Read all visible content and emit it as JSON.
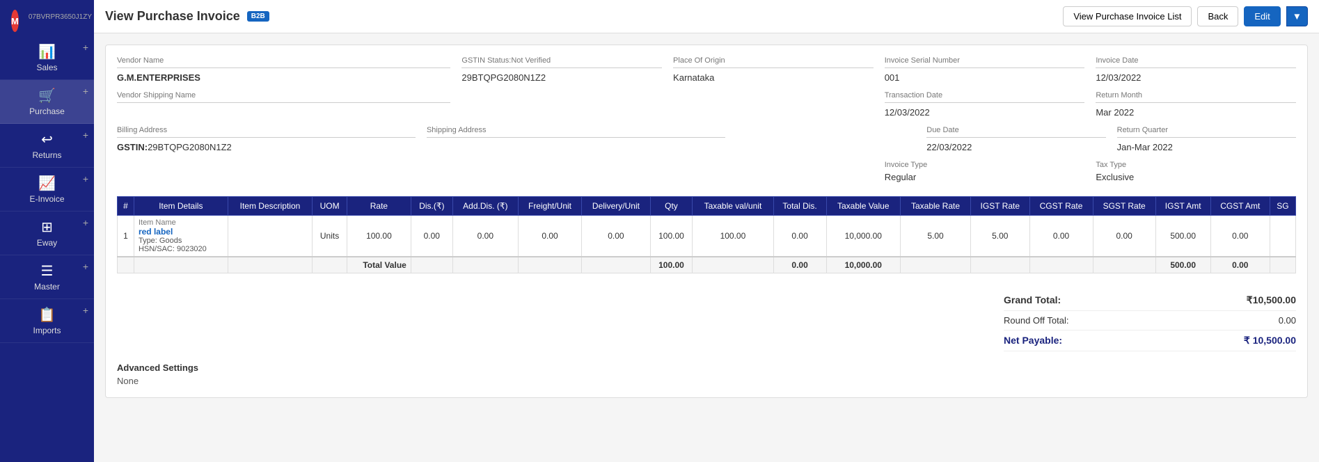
{
  "app": {
    "logo": "M",
    "logo_company": "07BVRPR3650J1ZY"
  },
  "sidebar": {
    "items": [
      {
        "label": "Sales",
        "icon": "📊",
        "active": false
      },
      {
        "label": "Purchase",
        "icon": "🛒",
        "active": true
      },
      {
        "label": "Returns",
        "icon": "↩",
        "active": false
      },
      {
        "label": "E-Invoice",
        "icon": "📈",
        "active": false
      },
      {
        "label": "Eway",
        "icon": "⊞",
        "active": false
      },
      {
        "label": "Master",
        "icon": "☰",
        "active": false
      },
      {
        "label": "Imports",
        "icon": "📋",
        "active": false
      }
    ]
  },
  "header": {
    "title": "View Purchase Invoice",
    "badge": "B2B",
    "buttons": {
      "list": "View Purchase Invoice List",
      "back": "Back",
      "edit": "Edit"
    }
  },
  "invoice": {
    "vendor_name_label": "Vendor Name",
    "vendor_name": "G.M.ENTERPRISES",
    "vendor_shipping_label": "Vendor Shipping Name",
    "vendor_shipping": "",
    "gstin_status_label": "GSTIN Status:Not Verified",
    "gstin_value": "29BTQPG2080N1Z2",
    "place_of_origin_label": "Place Of Origin",
    "place_of_origin": "Karnataka",
    "invoice_serial_label": "Invoice Serial Number",
    "invoice_serial": "001",
    "invoice_date_label": "Invoice Date",
    "invoice_date": "12/03/2022",
    "transaction_date_label": "Transaction Date",
    "transaction_date": "12/03/2022",
    "return_month_label": "Return Month",
    "return_month": "Mar 2022",
    "due_date_label": "Due Date",
    "due_date": "22/03/2022",
    "return_quarter_label": "Return Quarter",
    "return_quarter": "Jan-Mar 2022",
    "invoice_type_label": "Invoice Type",
    "invoice_type": "Regular",
    "tax_type_label": "Tax Type",
    "tax_type": "Exclusive",
    "billing_address_label": "Billing Address",
    "billing_gstin_label": "GSTIN:",
    "billing_gstin": "29BTQPG2080N1Z2",
    "shipping_address_label": "Shipping Address"
  },
  "table": {
    "headers": [
      "#",
      "Item Details",
      "Item Description",
      "UOM",
      "Rate",
      "Dis.(₹)",
      "Add.Dis. (₹)",
      "Freight/Unit",
      "Delivery/Unit",
      "Qty",
      "Taxable val/unit",
      "Total Dis.",
      "Taxable Value",
      "Taxable Rate",
      "IGST Rate",
      "CGST Rate",
      "SGST Rate",
      "IGST Amt",
      "CGST Amt",
      "SG"
    ],
    "rows": [
      {
        "num": "1",
        "item_name_label": "Item Name",
        "item_name": "red label",
        "item_type": "Type: Goods",
        "item_hsn": "HSN/SAC: 9023020",
        "item_description": "",
        "uom": "Units",
        "rate": "100.00",
        "dis": "0.00",
        "add_dis": "0.00",
        "freight": "0.00",
        "delivery": "0.00",
        "qty": "100.00",
        "taxable_val_unit": "100.00",
        "total_dis": "0.00",
        "taxable_value": "10,000.00",
        "taxable_rate": "5.00",
        "igst_rate": "5.00",
        "cgst_rate": "0.00",
        "sgst_rate": "0.00",
        "igst_amt": "500.00",
        "cgst_amt": "0.00",
        "sg": ""
      }
    ],
    "total_row": {
      "label": "Total Value",
      "qty": "100.00",
      "total_dis": "0.00",
      "taxable_value": "10,000.00",
      "igst_amt": "500.00",
      "cgst_amt": "0.00"
    }
  },
  "totals": {
    "grand_total_label": "Grand Total:",
    "grand_total": "₹10,500.00",
    "round_off_label": "Round Off Total:",
    "round_off": "0.00",
    "net_payable_label": "Net Payable:",
    "net_payable": "₹ 10,500.00"
  },
  "advanced": {
    "title": "Advanced Settings",
    "value": "None"
  }
}
